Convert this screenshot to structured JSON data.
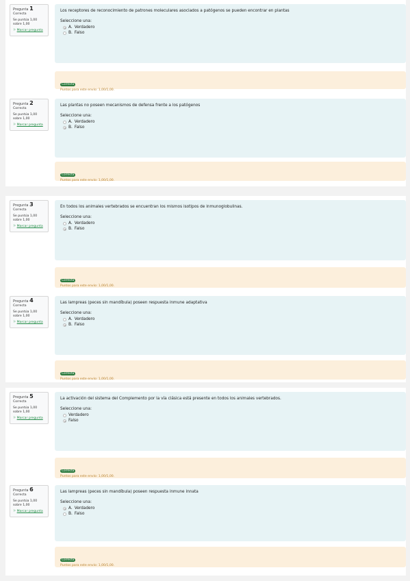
{
  "questions": [
    {
      "number_label": "Pregunta",
      "number": "1",
      "state": "Correcta",
      "grade": "Se puntúa 1,00 sobre 1,00",
      "flag_icon": "flag-icon",
      "flag_label": "Marcar pregunta",
      "text": "Los receptores de reconocimiento de patrones moleculares asociados a patógenos se pueden encontrar en plantas",
      "prompt": "Seleccione una:",
      "options": [
        {
          "letter": "A.",
          "label": "Verdadero",
          "selected": true
        },
        {
          "letter": "B.",
          "label": "Falso",
          "selected": false
        }
      ],
      "feedback_badge": "Correcta",
      "feedback_points": "Puntos para este envío: 1,00/1,00."
    },
    {
      "number_label": "Pregunta",
      "number": "2",
      "state": "Correcta",
      "grade": "Se puntúa 1,00 sobre 1,00",
      "flag_icon": "flag-icon",
      "flag_label": "Marcar pregunta",
      "text": "Las plantas no poseen mecanismos de defensa frente a los patógenos",
      "prompt": "Seleccione una:",
      "options": [
        {
          "letter": "A.",
          "label": "Verdadero",
          "selected": false
        },
        {
          "letter": "B.",
          "label": "Falso",
          "selected": true
        }
      ],
      "feedback_badge": "Correcta",
      "feedback_points": "Puntos para este envío: 1,00/1,00."
    },
    {
      "number_label": "Pregunta",
      "number": "3",
      "state": "Correcta",
      "grade": "Se puntúa 1,00 sobre 1,00",
      "flag_icon": "flag-icon",
      "flag_label": "Marcar pregunta",
      "text": "En todos los animales vertebrados se encuentran los mismos isotipos de inmunoglobulinas.",
      "prompt": "Seleccione una:",
      "options": [
        {
          "letter": "A.",
          "label": "Verdadero",
          "selected": false
        },
        {
          "letter": "B.",
          "label": "Falso",
          "selected": true
        }
      ],
      "feedback_badge": "Correcta",
      "feedback_points": "Puntos para este envío: 1,00/1,00."
    },
    {
      "number_label": "Pregunta",
      "number": "4",
      "state": "Correcta",
      "grade": "Se puntúa 1,00 sobre 1,00",
      "flag_icon": "flag-icon",
      "flag_label": "Marcar pregunta",
      "text": "Las lampreas (peces sin mandíbula) poseen respuesta inmune adaptativa",
      "prompt": "Seleccione una:",
      "options": [
        {
          "letter": "A.",
          "label": "Verdadero",
          "selected": false
        },
        {
          "letter": "B.",
          "label": "Falso",
          "selected": true
        }
      ],
      "feedback_badge": "Correcta",
      "feedback_points": "Puntos para este envío: 1,00/1,00."
    },
    {
      "number_label": "Pregunta",
      "number": "5",
      "state": "Correcta",
      "grade": "Se puntúa 1,00 sobre 1,00",
      "flag_icon": "flag-icon",
      "flag_label": "Marcar pregunta",
      "text": "La activación del sistema del Complemento por la vía clásica está presente en todos los animales vertebrados.",
      "prompt": "Seleccione una:",
      "options": [
        {
          "letter": "",
          "label": "Verdadero",
          "selected": false
        },
        {
          "letter": "",
          "label": "Falso",
          "selected": true
        }
      ],
      "feedback_badge": "Correcta",
      "feedback_points": "Puntos para este envío: 1,00/1,00."
    },
    {
      "number_label": "Pregunta",
      "number": "6",
      "state": "Correcta",
      "grade": "Se puntúa 1,00 sobre 1,00",
      "flag_icon": "flag-icon",
      "flag_label": "Marcar pregunta",
      "text": "Las lampreas (peces sin mandíbula) poseen respuesta inmune innata",
      "prompt": "Seleccione una:",
      "options": [
        {
          "letter": "A.",
          "label": "Verdadero",
          "selected": true
        },
        {
          "letter": "B.",
          "label": "Falso",
          "selected": false
        }
      ],
      "feedback_badge": "Correcta",
      "feedback_points": "Puntos para este envío: 1,00/1,00."
    }
  ]
}
